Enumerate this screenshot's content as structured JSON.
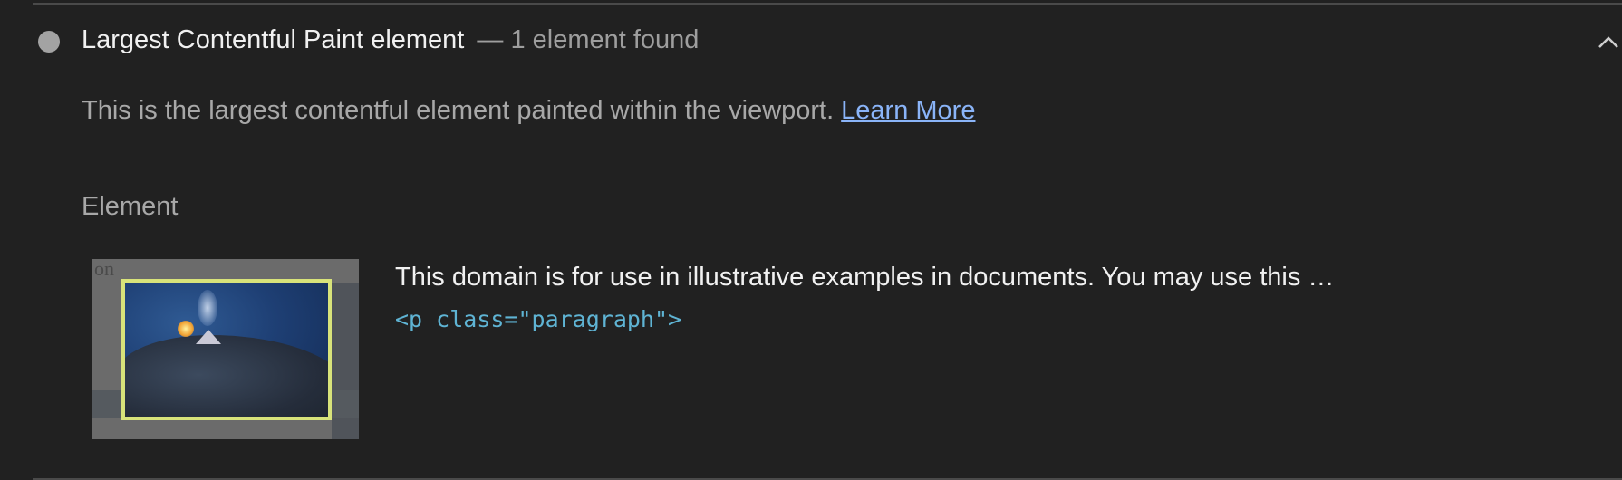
{
  "audit": {
    "title": "Largest Contentful Paint element",
    "separator": "—",
    "count_text": "1 element found",
    "status_color": "#a3a3a3",
    "expanded_icon": "chevron-up-icon",
    "description": "This is the largest contentful element painted within the viewport.",
    "learn_more": "Learn More"
  },
  "table": {
    "column_header": "Element",
    "rows": [
      {
        "thumbnail_icon": "element-screenshot",
        "thumbnail_corner_text": "on",
        "snippet": "This domain is for use in illustrative examples in documents. You may use this …",
        "node": "<p class=\"paragraph\">"
      }
    ]
  },
  "colors": {
    "background": "#212121",
    "link": "#8ab4f8",
    "node": "#5fb4d4",
    "highlight_border": "#d8e37a"
  }
}
